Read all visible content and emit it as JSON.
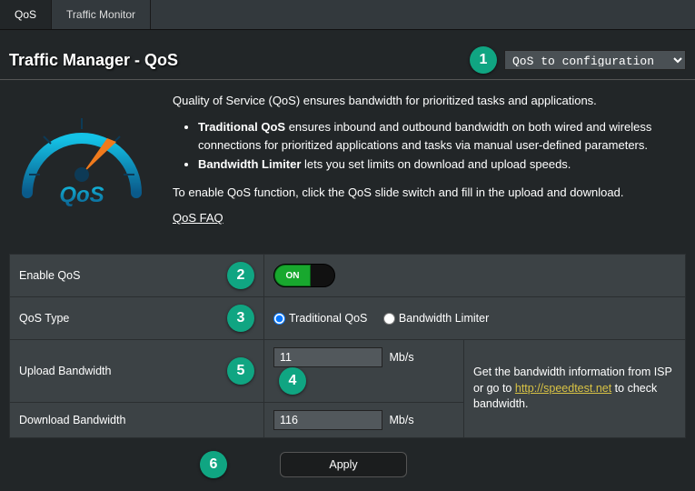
{
  "tabs": [
    {
      "label": "QoS",
      "active": true
    },
    {
      "label": "Traffic Monitor",
      "active": false
    }
  ],
  "page_title": "Traffic Manager - QoS",
  "dropdown": {
    "selected": "QoS to configuration"
  },
  "intro": {
    "line1": "Quality of Service (QoS) ensures bandwidth for prioritized tasks and applications.",
    "bullet1_bold": "Traditional QoS",
    "bullet1_rest": " ensures inbound and outbound bandwidth on both wired and wireless connections for prioritized applications and tasks via manual user-defined parameters.",
    "bullet2_bold": "Bandwidth Limiter",
    "bullet2_rest": " lets you set limits on download and upload speeds.",
    "line2": "To enable QoS function, click the QoS slide switch and fill in the upload and download.",
    "faq": "QoS FAQ"
  },
  "rows": {
    "enable_label": "Enable QoS",
    "toggle_on": "ON",
    "type_label": "QoS Type",
    "type_opt1": "Traditional QoS",
    "type_opt2": "Bandwidth Limiter",
    "upload_label": "Upload Bandwidth",
    "upload_value": "11",
    "download_label": "Download Bandwidth",
    "download_value": "116",
    "unit": "Mb/s",
    "hint_pre": "Get the bandwidth information from ISP or go to ",
    "hint_link": "http://speedtest.net",
    "hint_post": " to check bandwidth."
  },
  "apply_label": "Apply",
  "badges": {
    "b1": "1",
    "b2": "2",
    "b3": "3",
    "b4": "4",
    "b5": "5",
    "b6": "6"
  }
}
